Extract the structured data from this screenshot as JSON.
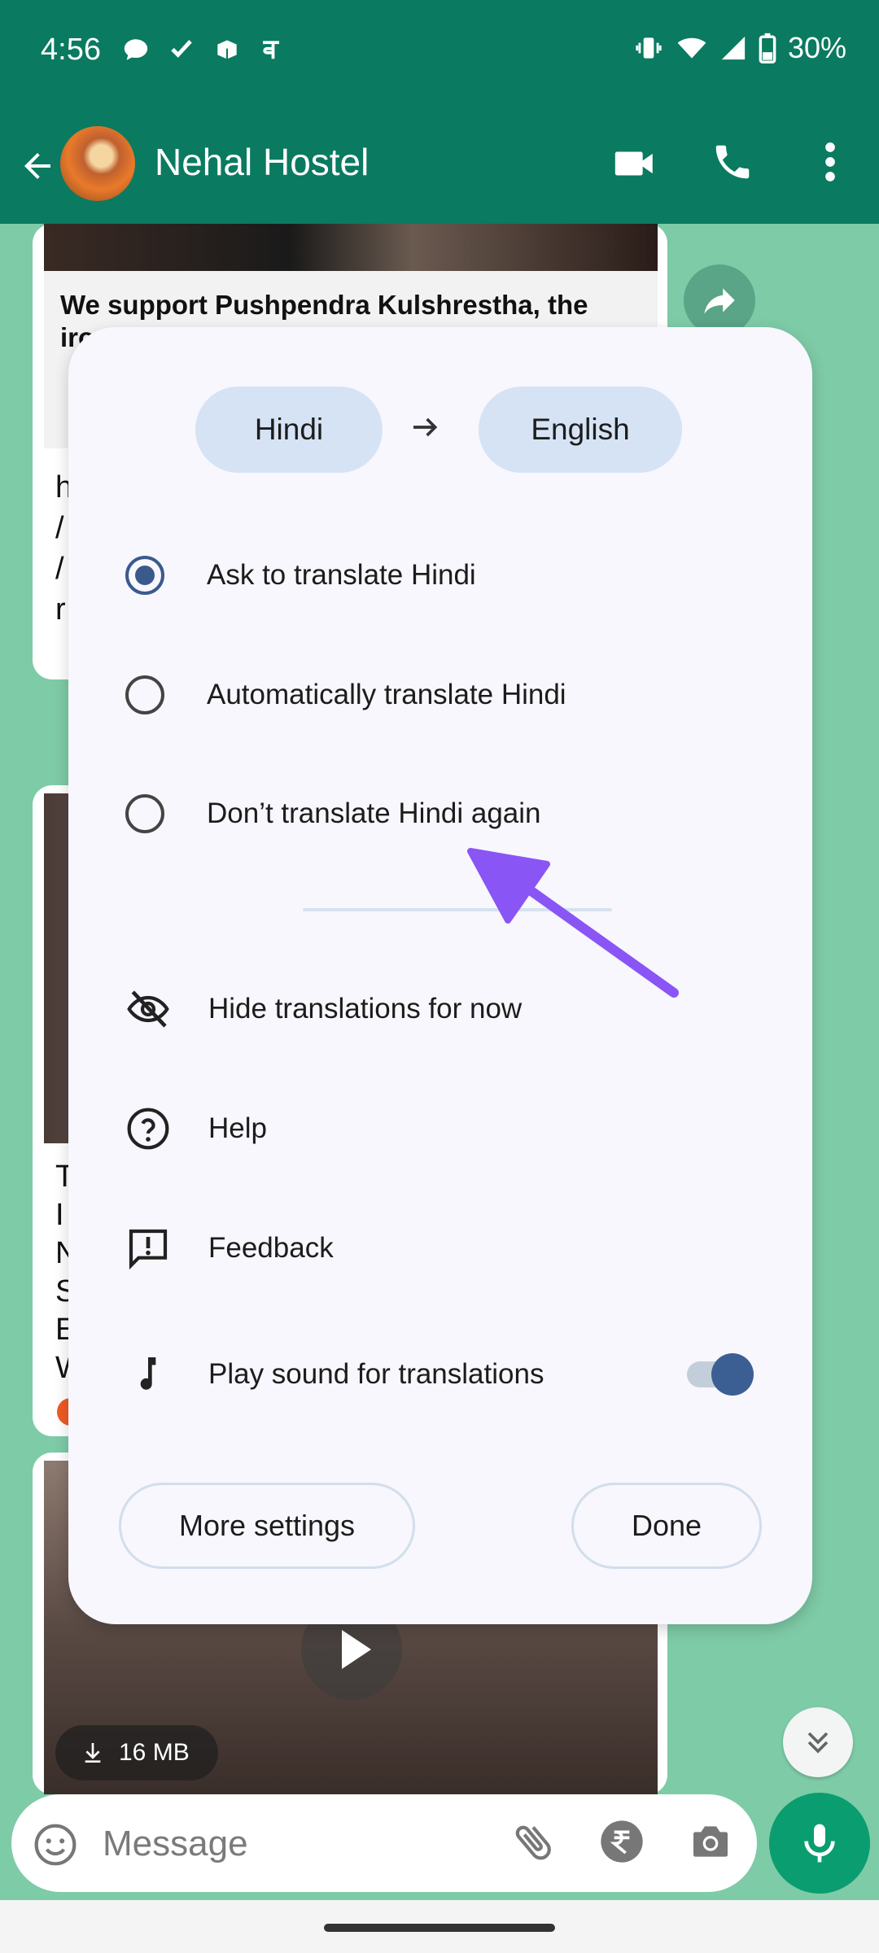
{
  "status_bar": {
    "time": "4:56",
    "battery": "30%"
  },
  "app_bar": {
    "chat_title": "Nehal Hostel"
  },
  "chat": {
    "link_preview_title": "We support Pushpendra Kulshrestha, the",
    "link_preview_title_cut": "iro",
    "media_size": "16 MB",
    "side_chars_1": [
      "h",
      "/",
      "/",
      "r"
    ],
    "side_chars_2": [
      "T",
      "I",
      "N",
      "S",
      "E",
      "W"
    ]
  },
  "composer": {
    "placeholder": "Message"
  },
  "translate_sheet": {
    "source_language": "Hindi",
    "target_language": "English",
    "options": [
      {
        "label": "Ask to translate Hindi",
        "selected": true
      },
      {
        "label": "Automatically translate Hindi",
        "selected": false
      },
      {
        "label": "Don’t translate Hindi again",
        "selected": false
      }
    ],
    "menu": {
      "hide": "Hide translations for now",
      "help": "Help",
      "feedback": "Feedback",
      "sound": "Play sound for translations"
    },
    "sound_toggle_on": true,
    "more_settings_label": "More settings",
    "done_label": "Done"
  },
  "colors": {
    "header": "#0a7a60",
    "chat_background": "#7ecba7",
    "accent": "#3b5f93",
    "annotation_arrow": "#8a55f5"
  }
}
